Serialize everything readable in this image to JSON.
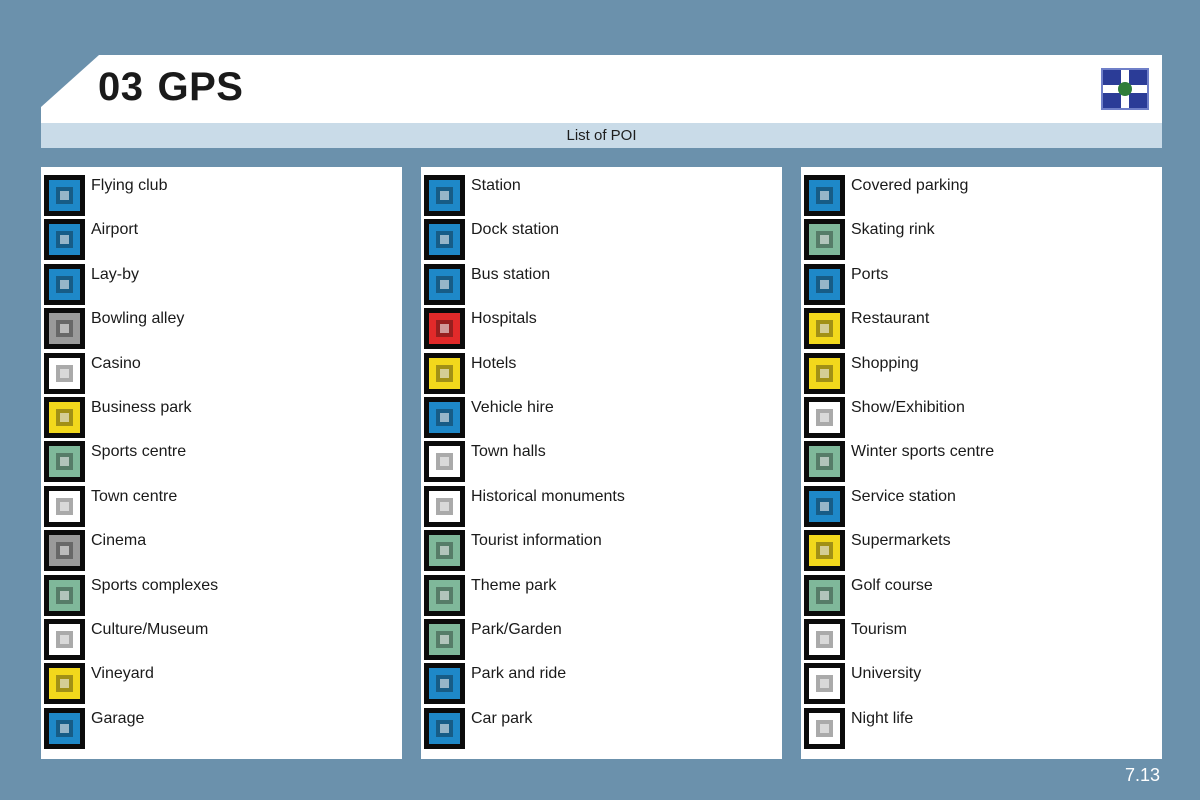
{
  "header": {
    "chapter": "03",
    "title": "GPS",
    "icon": "crossroads-icon",
    "accent": "#2b3c97"
  },
  "subtitle": "List of POI",
  "page_number": "7.13",
  "columns": [
    [
      {
        "label": "Flying club",
        "icon": "flying-club-icon",
        "color": "#1e88c8"
      },
      {
        "label": "Airport",
        "icon": "airport-icon",
        "color": "#1e88c8"
      },
      {
        "label": "Lay-by",
        "icon": "lay-by-icon",
        "color": "#1e88c8"
      },
      {
        "label": "Bowling alley",
        "icon": "bowling-alley-icon",
        "color": "#9a9a9a"
      },
      {
        "label": "Casino",
        "icon": "casino-icon",
        "color": "#ffffff"
      },
      {
        "label": "Business park",
        "icon": "business-park-icon",
        "color": "#f2d81c"
      },
      {
        "label": "Sports centre",
        "icon": "sports-centre-icon",
        "color": "#7fb89a"
      },
      {
        "label": "Town centre",
        "icon": "town-centre-icon",
        "color": "#ffffff"
      },
      {
        "label": "Cinema",
        "icon": "cinema-icon",
        "color": "#9a9a9a"
      },
      {
        "label": "Sports complexes",
        "icon": "sports-complexes-icon",
        "color": "#7fb89a"
      },
      {
        "label": "Culture/Museum",
        "icon": "culture-museum-icon",
        "color": "#ffffff"
      },
      {
        "label": "Vineyard",
        "icon": "vineyard-icon",
        "color": "#f2d81c"
      },
      {
        "label": "Garage",
        "icon": "garage-icon",
        "color": "#1e88c8"
      }
    ],
    [
      {
        "label": "Station",
        "icon": "station-icon",
        "color": "#1e88c8"
      },
      {
        "label": "Dock station",
        "icon": "dock-station-icon",
        "color": "#1e88c8"
      },
      {
        "label": "Bus station",
        "icon": "bus-station-icon",
        "color": "#1e88c8"
      },
      {
        "label": "Hospitals",
        "icon": "hospital-icon",
        "color": "#e22a2a"
      },
      {
        "label": "Hotels",
        "icon": "hotel-icon",
        "color": "#f2d81c"
      },
      {
        "label": "Vehicle hire",
        "icon": "vehicle-hire-icon",
        "color": "#1e88c8"
      },
      {
        "label": "Town halls",
        "icon": "town-hall-icon",
        "color": "#ffffff"
      },
      {
        "label": "Historical monuments",
        "icon": "historical-monument-icon",
        "color": "#ffffff"
      },
      {
        "label": "Tourist information",
        "icon": "tourist-information-icon",
        "color": "#7fb89a"
      },
      {
        "label": "Theme park",
        "icon": "theme-park-icon",
        "color": "#7fb89a"
      },
      {
        "label": "Park/Garden",
        "icon": "park-garden-icon",
        "color": "#7fb89a"
      },
      {
        "label": "Park and ride",
        "icon": "park-and-ride-icon",
        "color": "#1e88c8"
      },
      {
        "label": "Car park",
        "icon": "car-park-icon",
        "color": "#1e88c8"
      }
    ],
    [
      {
        "label": "Covered parking",
        "icon": "covered-parking-icon",
        "color": "#1e88c8"
      },
      {
        "label": "Skating rink",
        "icon": "skating-rink-icon",
        "color": "#7fb89a"
      },
      {
        "label": "Ports",
        "icon": "ports-icon",
        "color": "#1e88c8"
      },
      {
        "label": "Restaurant",
        "icon": "restaurant-icon",
        "color": "#f2d81c"
      },
      {
        "label": "Shopping",
        "icon": "shopping-icon",
        "color": "#f2d81c"
      },
      {
        "label": "Show/Exhibition",
        "icon": "show-exhibition-icon",
        "color": "#ffffff"
      },
      {
        "label": "Winter sports centre",
        "icon": "winter-sports-icon",
        "color": "#7fb89a"
      },
      {
        "label": "Service station",
        "icon": "service-station-icon",
        "color": "#1e88c8"
      },
      {
        "label": "Supermarkets",
        "icon": "supermarket-icon",
        "color": "#f2d81c"
      },
      {
        "label": "Golf course",
        "icon": "golf-course-icon",
        "color": "#7fb89a"
      },
      {
        "label": "Tourism",
        "icon": "tourism-icon",
        "color": "#ffffff"
      },
      {
        "label": "University",
        "icon": "university-icon",
        "color": "#ffffff"
      },
      {
        "label": "Night life",
        "icon": "night-life-icon",
        "color": "#ffffff"
      }
    ]
  ]
}
